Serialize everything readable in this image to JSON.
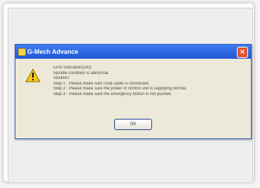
{
  "dialog": {
    "title": "G-Mech Advance",
    "close_glyph": "×",
    "icon": "warning-icon",
    "messages": [
      "Error indication(200)",
      "Spindle condition is abnormal.",
      "Solution:",
      "Step 1 : Please make sure USB cable is connected.",
      "Step 2 : Please make sure the power of control unit is supplying normal.",
      "Step 3 : Please make sure the emergency button is not pushed."
    ],
    "ok_label": "OK"
  },
  "colors": {
    "titlebar": "#2a5fe0",
    "dialog_bg": "#ece9d8",
    "close": "#e2572f",
    "warning": "#f5c518"
  }
}
